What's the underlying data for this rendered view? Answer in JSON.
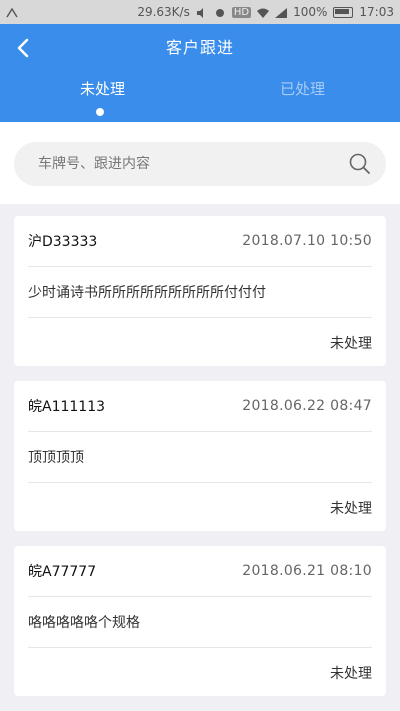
{
  "status_bar": {
    "speed": "29.63K/s",
    "hd": "HD",
    "battery": "100%",
    "time": "17:03"
  },
  "header": {
    "title": "客户跟进",
    "tabs": [
      {
        "label": "未处理",
        "active": true
      },
      {
        "label": "已处理",
        "active": false
      }
    ]
  },
  "search": {
    "placeholder": "车牌号、跟进内容",
    "value": ""
  },
  "records": [
    {
      "plate": "沪D33333",
      "datetime": "2018.07.10 10:50",
      "content": "少时诵诗书所所所所所所所所所付付付",
      "status": "未处理"
    },
    {
      "plate": "皖A111113",
      "datetime": "2018.06.22 08:47",
      "content": "顶顶顶顶",
      "status": "未处理"
    },
    {
      "plate": "皖A77777",
      "datetime": "2018.06.21 08:10",
      "content": "咯咯咯咯咯个规格",
      "status": "未处理"
    }
  ],
  "colors": {
    "primary": "#3a8dea",
    "background": "#efeff4"
  }
}
